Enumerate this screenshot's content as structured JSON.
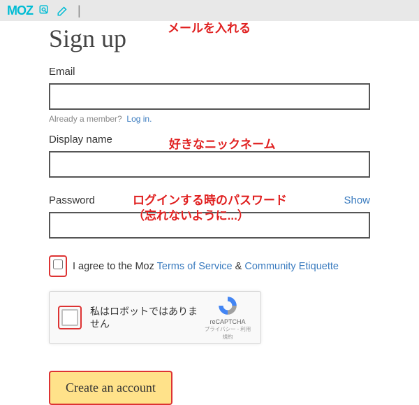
{
  "logo": "MOZ",
  "title": "Sign up",
  "email": {
    "label": "Email"
  },
  "already": {
    "text": "Already a member?",
    "login": "Log in."
  },
  "displayname": {
    "label": "Display name"
  },
  "password": {
    "label": "Password",
    "show": "Show"
  },
  "agree": {
    "prefix": "I agree to the Moz ",
    "tos": "Terms of Service",
    "amp": " & ",
    "etiquette": "Community Etiquette"
  },
  "recaptcha": {
    "label": "私はロボットではありません",
    "brand": "reCAPTCHA",
    "terms": "プライバシー - 利用規約"
  },
  "submit": "Create an account",
  "annotations": {
    "email": "メールを入れる",
    "display": "好きなニックネーム",
    "password1": "ログインする時のパスワード",
    "password2": "（忘れないように...）"
  }
}
